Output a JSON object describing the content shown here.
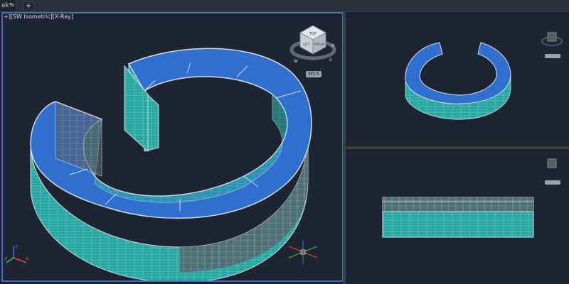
{
  "window": {
    "doc_tab_label": "ek*",
    "doc_tab_close": "×",
    "new_tab_label": "+"
  },
  "viewports": {
    "main": {
      "label": "+][SW Isometric][X-Ray]",
      "viewcube_faces": {
        "top": "TOP",
        "left": "LEFT",
        "front": "FRONT"
      },
      "compass": {
        "north": "N",
        "west": "W",
        "south": "S"
      },
      "ucs_label": "WCS",
      "axis_labels": {
        "x": "X",
        "y": "Y",
        "z": "Z"
      }
    },
    "top": {
      "ucs_label": ""
    },
    "front": {
      "ucs_label": ""
    }
  },
  "colors": {
    "background": "#1e2430",
    "viewport_active_border": "#3a6ec8",
    "model_blue": "#2e6fd0",
    "model_cyan": "#2ab8b0",
    "model_outline": "#d7dde6",
    "axis_x": "#e04a3a",
    "axis_y": "#3fbf4a",
    "axis_z": "#3a78e0"
  }
}
